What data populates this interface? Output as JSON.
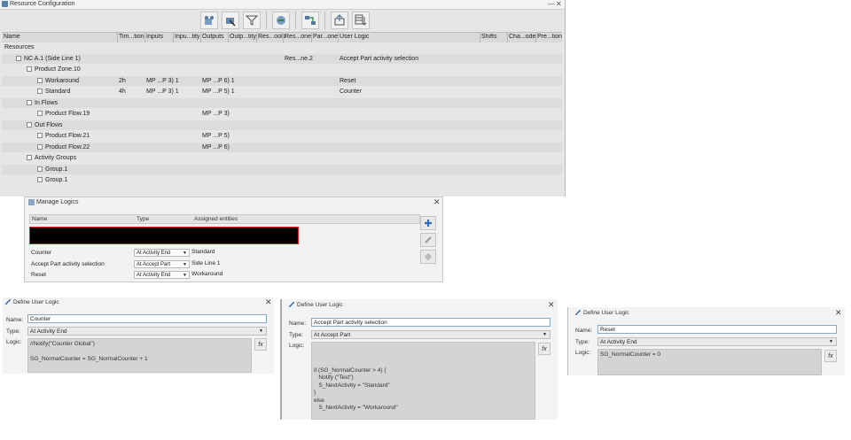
{
  "resource_config": {
    "title": "Resource Configuration",
    "minimize": "—",
    "close": "✕",
    "toolbar": [
      "resource-add-icon",
      "resource-edit-icon",
      "filter-icon",
      "flow-icon",
      "route-icon",
      "export-icon",
      "grid-settings-icon"
    ],
    "columns": [
      "Name",
      "Tim...tion",
      "Inputs",
      "Inpu...tity",
      "Outputs",
      "Outp...tity",
      "Res...ools",
      "Res...one",
      "Par...one",
      "User Logic",
      "Shifts",
      "Cha...ode",
      "Pre...tion"
    ],
    "rows": [
      {
        "name": "Resources",
        "time": "",
        "inputs": "",
        "outputs": "",
        "res": "",
        "logic": ""
      },
      {
        "name": "NC A.1 (Side Line 1)",
        "time": "",
        "inputs": "",
        "outputs": "",
        "res": "Res...ne.2",
        "logic": "Accept Part activity selection"
      },
      {
        "name": "Product Zone.10",
        "time": "",
        "inputs": "",
        "outputs": "",
        "res": "",
        "logic": ""
      },
      {
        "name": "Workaround",
        "time": "2h",
        "inputs": "MP ...P 3) 1",
        "outputs": "MP ...P 6) 1",
        "res": "",
        "logic": "Reset"
      },
      {
        "name": "Standard",
        "time": "4h",
        "inputs": "MP ...P 3) 1",
        "outputs": "MP ...P 5) 1",
        "res": "",
        "logic": "Counter"
      },
      {
        "name": "In Flows",
        "time": "",
        "inputs": "",
        "outputs": "",
        "res": "",
        "logic": ""
      },
      {
        "name": "Product Flow.19",
        "time": "",
        "inputs": "",
        "outputs": "MP ...P 3)",
        "res": "",
        "logic": ""
      },
      {
        "name": "Out Flows",
        "time": "",
        "inputs": "",
        "outputs": "",
        "res": "",
        "logic": ""
      },
      {
        "name": "Product Flow.21",
        "time": "",
        "inputs": "",
        "outputs": "MP ...P 5)",
        "res": "",
        "logic": ""
      },
      {
        "name": "Product Flow.22",
        "time": "",
        "inputs": "",
        "outputs": "MP ...P 6)",
        "res": "",
        "logic": ""
      },
      {
        "name": "Activity Groups",
        "time": "",
        "inputs": "",
        "outputs": "",
        "res": "",
        "logic": ""
      },
      {
        "name": "Group.1",
        "time": "",
        "inputs": "",
        "outputs": "",
        "res": "",
        "logic": ""
      },
      {
        "name": "Group.1",
        "time": "",
        "inputs": "",
        "outputs": "",
        "res": "",
        "logic": ""
      }
    ]
  },
  "manage_logics": {
    "title": "Manage Logics",
    "close": "✕",
    "columns": [
      "Name",
      "Type",
      "Assigned entities"
    ],
    "rows": [
      {
        "name": "Counter",
        "type": "At Activity End",
        "assigned": "Standard"
      },
      {
        "name": "Accept Part activity selection",
        "type": "At Accept Part",
        "assigned": "Side Line 1"
      },
      {
        "name": "Reset",
        "type": "At Activity End",
        "assigned": "Workaround"
      }
    ],
    "buttons": [
      "add-icon",
      "edit-icon",
      "erase-icon"
    ]
  },
  "define_logic_dialogs": [
    {
      "title": "Define User Logic",
      "name_label": "Name:",
      "name": "Counter",
      "type_label": "Type:",
      "type": "At Activity End",
      "logic_label": "Logic:",
      "fx": "fx",
      "code": "//Notify(\"Counter Global\")\n\nSG_NormalCounter = SG_NormalCounter + 1"
    },
    {
      "title": "Define User Logic",
      "name_label": "Name:",
      "name": "Accept Part activity selection",
      "type_label": "Type:",
      "type": "At Accept Part",
      "logic_label": "Logic:",
      "fx": "fx",
      "code": "\n\n\nif (SG_NormalCounter > 4) {\n   Notify (\"Test\")\n   S_NextActivity = \"Standard\"\n}\nelse\n   S_NextActivity = \"Workaround\""
    },
    {
      "title": "Define User Logic",
      "name_label": "Name:",
      "name": "Reset",
      "type_label": "Type:",
      "type": "At Activity End",
      "logic_label": "Logic:",
      "fx": "fx",
      "code": "SG_NormalCounter = 0"
    }
  ]
}
